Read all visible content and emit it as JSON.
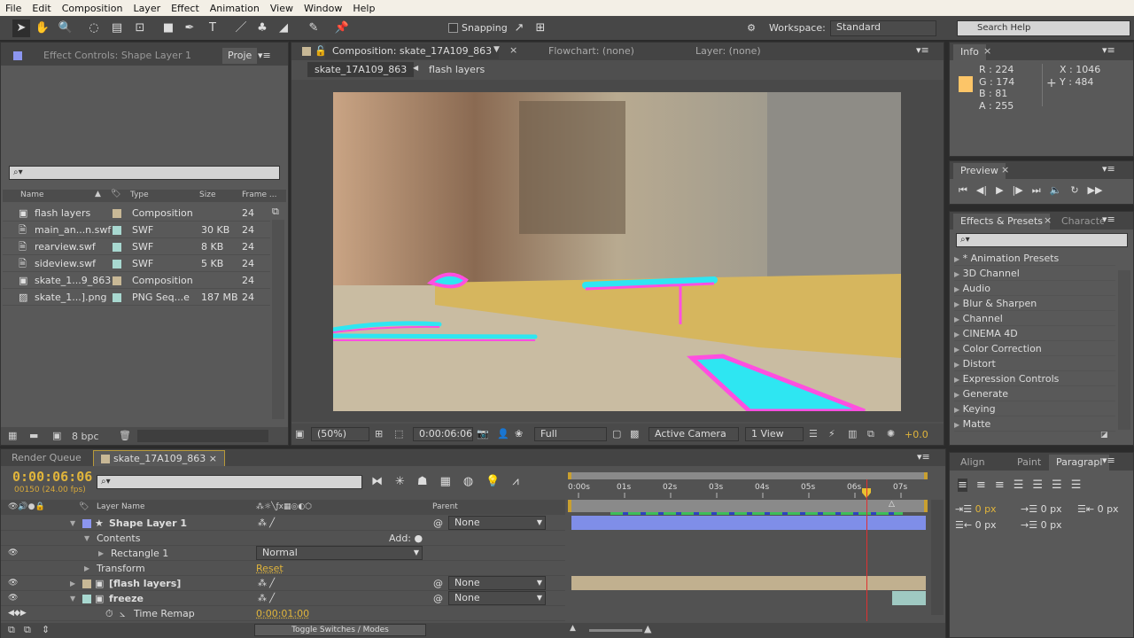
{
  "menu": [
    "File",
    "Edit",
    "Composition",
    "Layer",
    "Effect",
    "Animation",
    "View",
    "Window",
    "Help"
  ],
  "toolbar": {
    "snapping": "Snapping",
    "workspace_label": "Workspace:",
    "workspace_value": "Standard",
    "search_placeholder": "Search Help"
  },
  "left_panel": {
    "tab_effect_controls": "Effect Controls: Shape Layer 1",
    "tab_project": "Proje",
    "columns": {
      "name": "Name",
      "type": "Type",
      "size": "Size",
      "frame": "Frame ..."
    },
    "items": [
      {
        "name": "flash layers",
        "type": "Composition",
        "size": "",
        "frame": "24",
        "label_color": "#c8b896",
        "icon": "composition-icon"
      },
      {
        "name": "main_an...n.swf",
        "type": "SWF",
        "size": "30 KB",
        "frame": "24",
        "label_color": "#a8d8d0",
        "icon": "swf-file-icon"
      },
      {
        "name": "rearview.swf",
        "type": "SWF",
        "size": "8 KB",
        "frame": "24",
        "label_color": "#a8d8d0",
        "icon": "swf-file-icon"
      },
      {
        "name": "sideview.swf",
        "type": "SWF",
        "size": "5 KB",
        "frame": "24",
        "label_color": "#a8d8d0",
        "icon": "swf-file-icon"
      },
      {
        "name": "skate_1...9_863",
        "type": "Composition",
        "size": "",
        "frame": "24",
        "label_color": "#c8b896",
        "icon": "composition-icon"
      },
      {
        "name": "skate_1...].png",
        "type": "PNG Seq...e",
        "size": "187 MB",
        "frame": "24",
        "label_color": "#a8d8d0",
        "icon": "image-sequence-icon"
      }
    ],
    "bpc": "8 bpc"
  },
  "comp_panel": {
    "tab_composition": "Composition: skate_17A109_863",
    "tab_flowchart": "Flowchart: (none)",
    "tab_layer": "Layer: (none)",
    "breadcrumb": [
      "skate_17A109_863",
      "flash layers"
    ],
    "zoom": "(50%)",
    "timecode": "0:00:06:06",
    "resolution": "Full",
    "camera": "Active Camera",
    "views": "1 View",
    "exposure": "+0.0"
  },
  "info": {
    "tab": "Info",
    "r": "R : 224",
    "g": "G : 174",
    "b": "B : 81",
    "a": "A : 255",
    "x": "X : 1046",
    "y": "Y : 484",
    "swatch": "#e0ae51"
  },
  "preview": {
    "tab": "Preview"
  },
  "effects": {
    "tab": "Effects & Presets",
    "tab_character": "Characte",
    "items": [
      "* Animation Presets",
      "3D Channel",
      "Audio",
      "Blur & Sharpen",
      "Channel",
      "CINEMA 4D",
      "Color Correction",
      "Distort",
      "Expression Controls",
      "Generate",
      "Keying",
      "Matte"
    ]
  },
  "paragraph": {
    "tab_align": "Align",
    "tab_paint": "Paint",
    "tab_paragraph": "Paragrapl",
    "values": [
      "0 px",
      "0 px",
      "0 px",
      "0 px",
      "0 px"
    ]
  },
  "timeline": {
    "tab_render_queue": "Render Queue",
    "tab_comp": "skate_17A109_863",
    "timecode": "0:00:06:06",
    "frame_info": "00150 (24.00 fps)",
    "col_layer_name": "Layer Name",
    "col_parent": "Parent",
    "ruler": [
      "0:00s",
      "01s",
      "02s",
      "03s",
      "04s",
      "05s",
      "06s",
      "07s"
    ],
    "playhead_seconds": 6.25,
    "layers": [
      {
        "name": "Shape Layer 1",
        "parent": "None",
        "color": "#8c96f0"
      },
      {
        "name": "Contents",
        "add_label": "Add:"
      },
      {
        "name": "Rectangle 1",
        "mode": "Normal"
      },
      {
        "name": "Transform",
        "value": "Reset"
      },
      {
        "name": "[flash layers]",
        "parent": "None",
        "color": "#c8b896"
      },
      {
        "name": "freeze",
        "parent": "None",
        "color": "#a8d8d0"
      },
      {
        "name": "Time Remap",
        "value": "0:00:01:00"
      }
    ],
    "toggle": "Toggle Switches / Modes"
  }
}
